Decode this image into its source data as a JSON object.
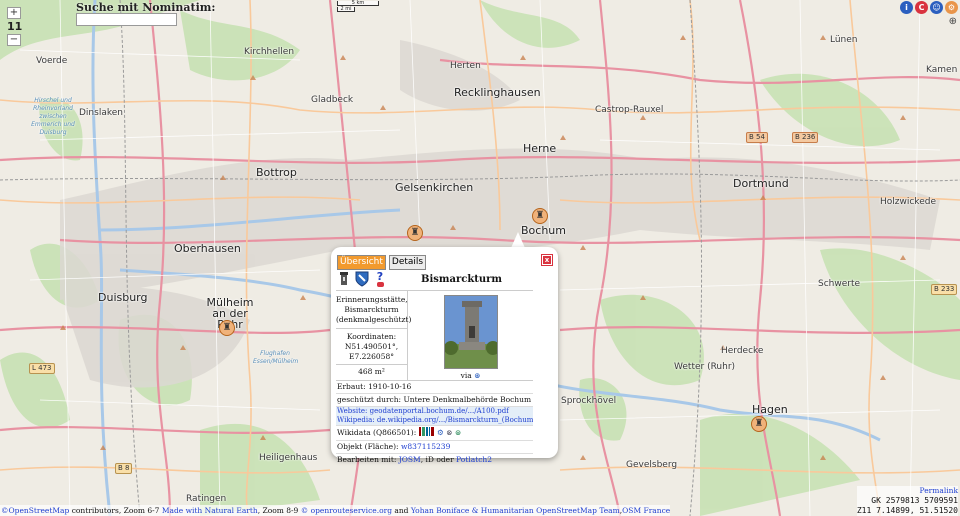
{
  "search": {
    "label": "Suche mit Nominatim:",
    "placeholder": ""
  },
  "zoom": {
    "in": "+",
    "level": "11",
    "out": "−"
  },
  "scale": {
    "top": "5 km",
    "bottom": "2 mi"
  },
  "top_icons": [
    {
      "name": "info-icon",
      "glyph": "i",
      "color": "#2b5fbf"
    },
    {
      "name": "copyright-icon",
      "glyph": "C",
      "color": "#d9333f"
    },
    {
      "name": "user-icon",
      "glyph": "☺",
      "color": "#2b5fbf"
    },
    {
      "name": "settings-icon",
      "glyph": "⚙",
      "color": "#e9954a"
    }
  ],
  "layers_icon": "⊕",
  "map": {
    "cities": [
      {
        "label": "Recklinghausen",
        "big": true
      },
      {
        "label": "Herten",
        "big": false
      },
      {
        "label": "Lünen",
        "big": false
      },
      {
        "label": "Kamen",
        "big": false
      },
      {
        "label": "Kirchhellen",
        "big": false
      },
      {
        "label": "Voerde",
        "big": false
      },
      {
        "label": "Gladbeck",
        "big": false
      },
      {
        "label": "Dinslaken",
        "big": false
      },
      {
        "label": "Castrop-Rauxel",
        "big": false
      },
      {
        "label": "Herne",
        "big": true
      },
      {
        "label": "Bottrop",
        "big": true
      },
      {
        "label": "Gelsenkirchen",
        "big": true
      },
      {
        "label": "Dortmund",
        "big": true
      },
      {
        "label": "Holzwickede",
        "big": false
      },
      {
        "label": "Oberhausen",
        "big": true
      },
      {
        "label": "Bochum",
        "big": true
      },
      {
        "label": "Duisburg",
        "big": true
      },
      {
        "label": "Mülheim an der Ruhr",
        "big": true
      },
      {
        "label": "Schwerte",
        "big": false
      },
      {
        "label": "Wetter (Ruhr)",
        "big": false
      },
      {
        "label": "Herdecke",
        "big": false
      },
      {
        "label": "Hagen",
        "big": true
      },
      {
        "label": "Heiligenhaus",
        "big": false
      },
      {
        "label": "Gevelsberg",
        "big": false
      },
      {
        "label": "Ratingen",
        "big": false
      },
      {
        "label": "Sprockhövel",
        "big": false
      }
    ],
    "water_labels": [
      "Hirschel und Rheinvorland zwischen Emmerich und Duisburg",
      "Flughafen Essen/Mülheim"
    ],
    "road_shields": [
      "B 54",
      "B 236",
      "B 233",
      "L 473",
      "B 8"
    ]
  },
  "popup": {
    "tabs": [
      "Übersicht",
      "Details"
    ],
    "close": "x",
    "title": "Bismarckturm",
    "icons": [
      {
        "name": "tower-icon",
        "glyph": "🗼"
      },
      {
        "name": "coat-of-arms-icon",
        "glyph": "🛡"
      },
      {
        "name": "unknown-icon",
        "glyph": "?"
      }
    ],
    "type_line": "Erinnerungsstätte, Bismarckturm (denkmalgeschützt)",
    "coords_label": "Koordinaten:",
    "coords_lat": "N51.490501°,",
    "coords_lon": "E7.226058°",
    "area": "468 m²",
    "via": "via",
    "built": "Erbaut: 1910-10-16",
    "protected": "geschützt durch: Untere Denkmalbehörde Bochum",
    "website_label": "Website:",
    "website": "geodatenportal.bochum.de/.../A100.pdf",
    "wikipedia_label": "Wikipedia:",
    "wikipedia": "de.wikipedia.org/.../Bismarckturm_(Bochum)",
    "wikidata": "Wikidata (Q866501):",
    "object_label": "Objekt (Fläche):",
    "object_id": "w837115239",
    "edit_label": "Bearbeiten mit:",
    "edit_josm": "JOSM",
    "edit_mid": ", iD oder",
    "edit_potlatch": "Potlatch2"
  },
  "attribution": {
    "a": "©OpenStreetMap",
    "b": " contributors, Zoom 6-7 ",
    "c": "Made with Natural Earth",
    "d": ", Zoom 8-9 ",
    "e": "© openrouteservice.org",
    "f": " and ",
    "g": "Yohan Boniface & Humanitarian OpenStreetMap Team",
    "h": ",",
    "i": "OSM France"
  },
  "coords": {
    "permalink": "Permalink",
    "gk": "GK 2579813 5709591",
    "z": "Z11 7.14899, 51.51520"
  }
}
